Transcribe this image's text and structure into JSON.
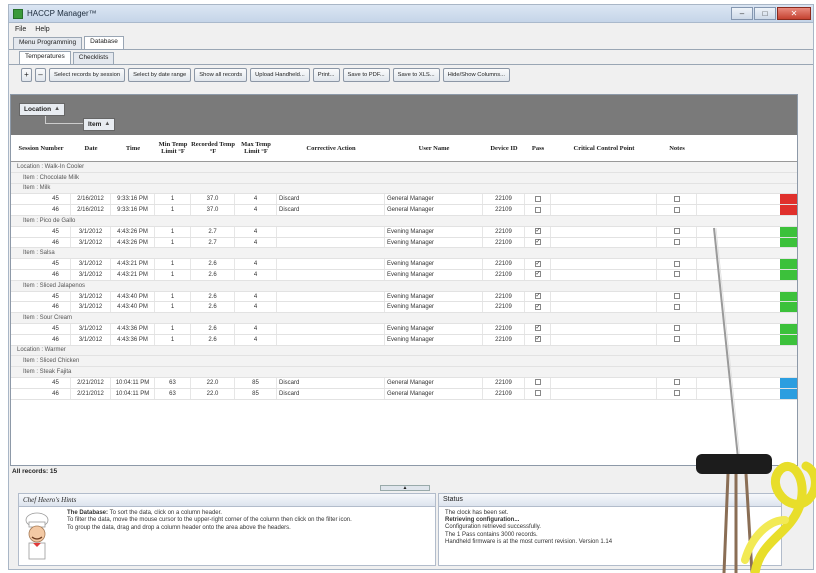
{
  "window": {
    "title": "HACCP Manager™",
    "min": "–",
    "max": "□",
    "close": "✕"
  },
  "menu": [
    "File",
    "Help"
  ],
  "main_tabs": [
    "Menu Programming",
    "Database"
  ],
  "sub_tabs": [
    "Temperatures",
    "Checklists"
  ],
  "toolbar": {
    "add": "+",
    "remove": "–",
    "buttons": [
      "Select records by session",
      "Select by date range",
      "Show all records",
      "Upload Handheld...",
      "Print...",
      "Save to PDF...",
      "Save to XLS...",
      "Hide/Show Columns..."
    ]
  },
  "group_chips": {
    "location": "Location",
    "item": "Item",
    "sort_arrow": "▲"
  },
  "columns": [
    "Session Number",
    "Date",
    "Time",
    "Min Temp Limit °F",
    "Recorded Temp °F",
    "Max Temp Limit °F",
    "Corrective Action",
    "User Name",
    "Device ID",
    "Pass",
    "Critical Control Point",
    "Notes"
  ],
  "check_mark": "✓",
  "rows": [
    {
      "kind": "group",
      "level": 1,
      "text": "Location : Walk-In Cooler"
    },
    {
      "kind": "group",
      "level": 2,
      "text": "Item : Chocolate Milk"
    },
    {
      "kind": "group",
      "level": 2,
      "text": "Item : Milk"
    },
    {
      "kind": "data",
      "session": "45",
      "date": "2/16/2012",
      "time": "9:33:16 PM",
      "min": "1",
      "rec": "37.0",
      "max": "4",
      "action": "Discard",
      "user": "General Manager",
      "device": "22109",
      "pass": false,
      "status": "#e0302c"
    },
    {
      "kind": "data",
      "session": "46",
      "date": "2/16/2012",
      "time": "9:33:16 PM",
      "min": "1",
      "rec": "37.0",
      "max": "4",
      "action": "Discard",
      "user": "General Manager",
      "device": "22109",
      "pass": false,
      "status": "#e0302c"
    },
    {
      "kind": "group",
      "level": 2,
      "text": "Item : Pico de Gallo"
    },
    {
      "kind": "data",
      "session": "45",
      "date": "3/1/2012",
      "time": "4:43:26 PM",
      "min": "1",
      "rec": "2.7",
      "max": "4",
      "action": "",
      "user": "Evening Manager",
      "device": "22109",
      "pass": true,
      "status": "#3cc13b"
    },
    {
      "kind": "data",
      "session": "46",
      "date": "3/1/2012",
      "time": "4:43:26 PM",
      "min": "1",
      "rec": "2.7",
      "max": "4",
      "action": "",
      "user": "Evening Manager",
      "device": "22109",
      "pass": true,
      "status": "#3cc13b"
    },
    {
      "kind": "group",
      "level": 2,
      "text": "Item : Salsa"
    },
    {
      "kind": "data",
      "session": "45",
      "date": "3/1/2012",
      "time": "4:43:21 PM",
      "min": "1",
      "rec": "2.6",
      "max": "4",
      "action": "",
      "user": "Evening Manager",
      "device": "22109",
      "pass": true,
      "status": "#3cc13b"
    },
    {
      "kind": "data",
      "session": "46",
      "date": "3/1/2012",
      "time": "4:43:21 PM",
      "min": "1",
      "rec": "2.6",
      "max": "4",
      "action": "",
      "user": "Evening Manager",
      "device": "22109",
      "pass": true,
      "status": "#3cc13b"
    },
    {
      "kind": "group",
      "level": 2,
      "text": "Item : Sliced Jalapenos"
    },
    {
      "kind": "data",
      "session": "45",
      "date": "3/1/2012",
      "time": "4:43:40 PM",
      "min": "1",
      "rec": "2.6",
      "max": "4",
      "action": "",
      "user": "Evening Manager",
      "device": "22109",
      "pass": true,
      "status": "#3cc13b"
    },
    {
      "kind": "data",
      "session": "46",
      "date": "3/1/2012",
      "time": "4:43:40 PM",
      "min": "1",
      "rec": "2.6",
      "max": "4",
      "action": "",
      "user": "Evening Manager",
      "device": "22109",
      "pass": true,
      "status": "#3cc13b"
    },
    {
      "kind": "group",
      "level": 2,
      "text": "Item : Sour Cream"
    },
    {
      "kind": "data",
      "session": "45",
      "date": "3/1/2012",
      "time": "4:43:36 PM",
      "min": "1",
      "rec": "2.6",
      "max": "4",
      "action": "",
      "user": "Evening Manager",
      "device": "22109",
      "pass": true,
      "status": "#3cc13b"
    },
    {
      "kind": "data",
      "session": "46",
      "date": "3/1/2012",
      "time": "4:43:36 PM",
      "min": "1",
      "rec": "2.6",
      "max": "4",
      "action": "",
      "user": "Evening Manager",
      "device": "22109",
      "pass": true,
      "status": "#3cc13b"
    },
    {
      "kind": "group",
      "level": 1,
      "text": "Location : Warmer"
    },
    {
      "kind": "group",
      "level": 2,
      "text": "Item : Sliced Chicken"
    },
    {
      "kind": "group",
      "level": 2,
      "text": "Item : Steak Fajita"
    },
    {
      "kind": "data",
      "session": "45",
      "date": "2/21/2012",
      "time": "10:04:11 PM",
      "min": "63",
      "rec": "22.0",
      "max": "85",
      "action": "Discard",
      "user": "General Manager",
      "device": "22109",
      "pass": false,
      "status": "#2b9ee0"
    },
    {
      "kind": "data",
      "session": "46",
      "date": "2/21/2012",
      "time": "10:04:11 PM",
      "min": "63",
      "rec": "22.0",
      "max": "85",
      "action": "Discard",
      "user": "General Manager",
      "device": "22109",
      "pass": false,
      "status": "#2b9ee0"
    }
  ],
  "footer": {
    "records": "All records: 15"
  },
  "hints": {
    "title": "Chef Heero's Hints",
    "lead": "The Database:",
    "p1": " To sort the data, click on a column header.",
    "p2": "To filter the data, move the mouse cursor to the upper-right corner of the column then click on the filter icon.",
    "p3": "To group the data, drag and drop a column header onto the area above the headers."
  },
  "status": {
    "title": "Status",
    "lines": [
      "The clock has been set.",
      "Retrieving configuration...",
      "Configuration retrieved successfully.",
      "The 1 Pass contains 3000 records.",
      "Handheld firmware is at the most current revision. Version 1.14"
    ]
  }
}
